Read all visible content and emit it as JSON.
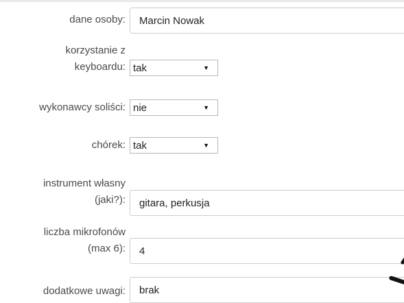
{
  "form": {
    "person": {
      "label": "dane osoby:",
      "value": "Marcin Nowak"
    },
    "keyboard": {
      "label_line1": "korzystanie z",
      "label_line2": "keyboardu:",
      "selected": "tak"
    },
    "soloists": {
      "label": "wykonawcy soliści:",
      "selected": "nie"
    },
    "choir": {
      "label": "chórek:",
      "selected": "tak"
    },
    "instrument": {
      "label_line1": "instrument własny",
      "label_line2": "(jaki?):",
      "value": "gitara, perkusja"
    },
    "microphones": {
      "label_line1": "liczba mikrofonów",
      "label_line2": "(max 6):",
      "value": "4"
    },
    "notes": {
      "label": "dodatkowe uwagi:",
      "value": "brak"
    }
  },
  "icons": {
    "select_arrow": "triangle-down-icon"
  }
}
